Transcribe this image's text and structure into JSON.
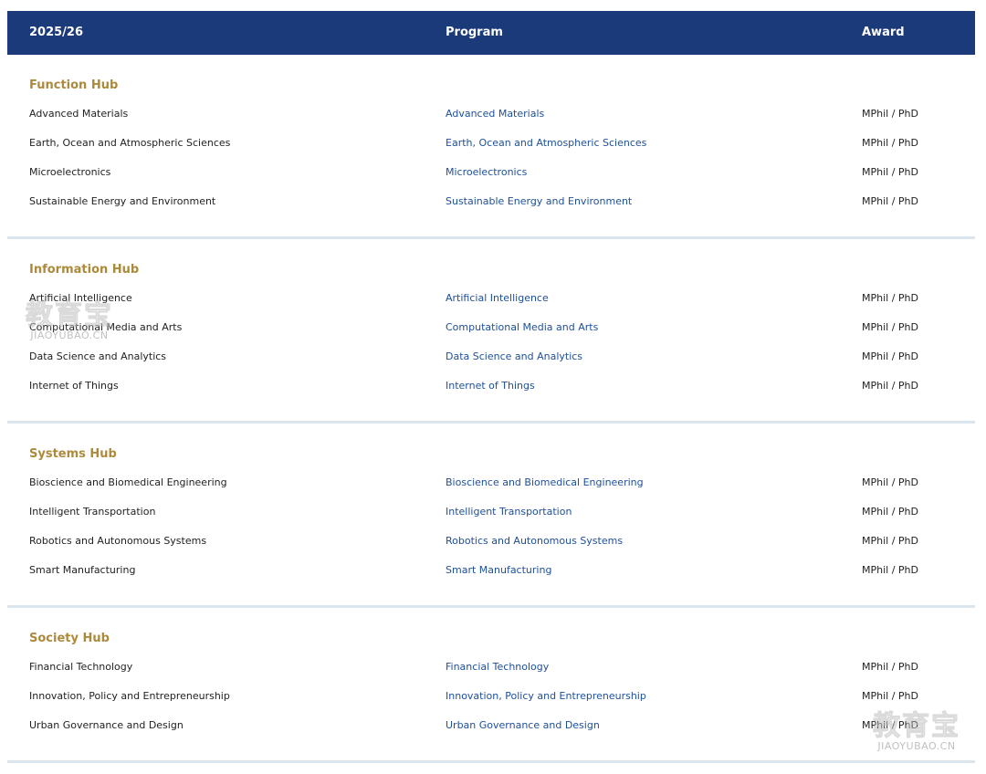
{
  "header": {
    "year": "2025/26",
    "program": "Program",
    "award": "Award"
  },
  "colors": {
    "header_bg": "#1b3a7a",
    "hub_title": "#ad8a3b",
    "link": "#1e4f9a",
    "divider": "#dbe5ee"
  },
  "hubs": [
    {
      "title": "Function Hub",
      "rows": [
        {
          "name": "Advanced Materials",
          "program": "Advanced Materials",
          "award": "MPhil / PhD"
        },
        {
          "name": "Earth, Ocean and Atmospheric Sciences",
          "program": "Earth, Ocean and Atmospheric Sciences",
          "award": "MPhil / PhD"
        },
        {
          "name": "Microelectronics",
          "program": "Microelectronics",
          "award": "MPhil / PhD"
        },
        {
          "name": "Sustainable Energy and Environment",
          "program": "Sustainable Energy and Environment",
          "award": "MPhil / PhD"
        }
      ]
    },
    {
      "title": "Information Hub",
      "rows": [
        {
          "name": "Artificial Intelligence",
          "program": "Artificial Intelligence",
          "award": "MPhil / PhD"
        },
        {
          "name": "Computational Media and Arts",
          "program": "Computational Media and Arts",
          "award": "MPhil / PhD"
        },
        {
          "name": "Data Science and Analytics",
          "program": "Data Science and Analytics",
          "award": "MPhil / PhD"
        },
        {
          "name": "Internet of Things",
          "program": "Internet of Things",
          "award": "MPhil / PhD"
        }
      ]
    },
    {
      "title": "Systems Hub",
      "rows": [
        {
          "name": "Bioscience and Biomedical Engineering",
          "program": "Bioscience and Biomedical Engineering",
          "award": "MPhil / PhD"
        },
        {
          "name": "Intelligent Transportation",
          "program": "Intelligent Transportation",
          "award": "MPhil / PhD"
        },
        {
          "name": "Robotics and Autonomous Systems",
          "program": "Robotics and Autonomous Systems",
          "award": "MPhil / PhD"
        },
        {
          "name": "Smart Manufacturing",
          "program": "Smart Manufacturing",
          "award": "MPhil / PhD"
        }
      ]
    },
    {
      "title": "Society Hub",
      "rows": [
        {
          "name": "Financial Technology",
          "program": "Financial Technology",
          "award": "MPhil / PhD"
        },
        {
          "name": "Innovation, Policy and Entrepreneurship",
          "program": "Innovation, Policy and Entrepreneurship",
          "award": "MPhil / PhD"
        },
        {
          "name": "Urban Governance and Design",
          "program": "Urban Governance and Design",
          "award": "MPhil / PhD"
        }
      ]
    }
  ],
  "watermark": {
    "zh": "教育宝",
    "en": "JIAOYUBAO.CN"
  }
}
